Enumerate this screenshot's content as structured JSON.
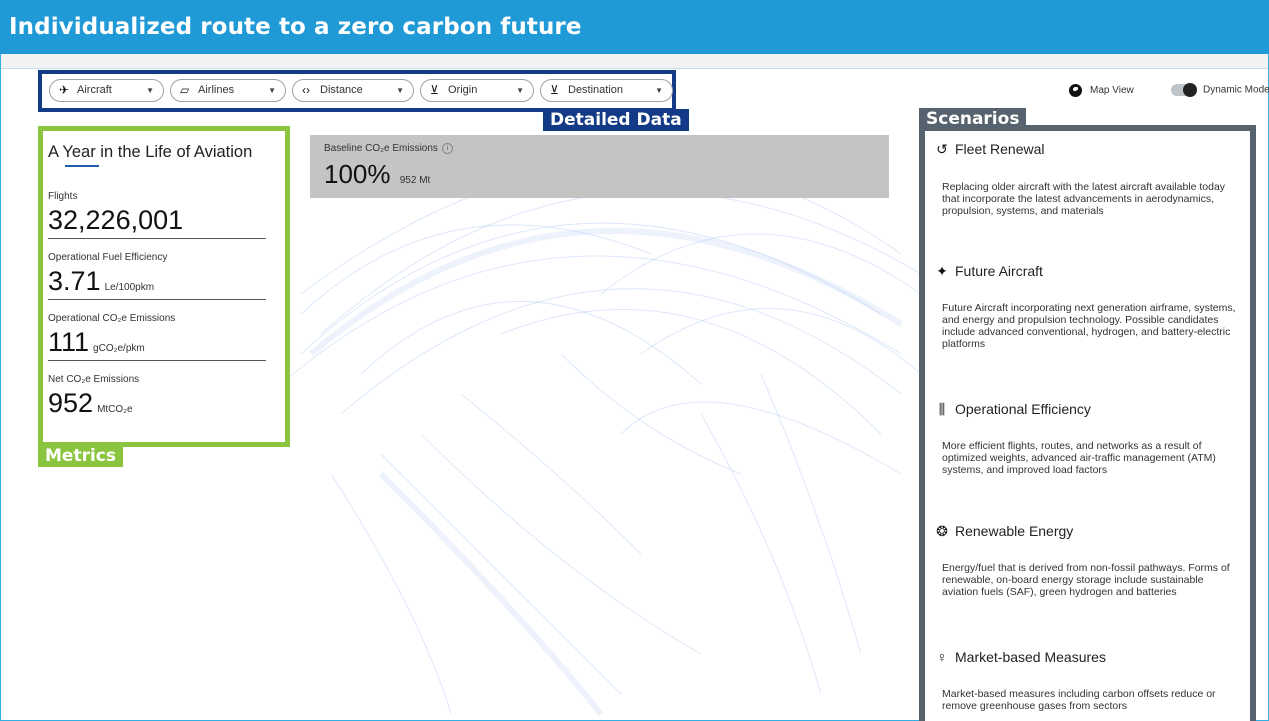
{
  "header": {
    "title": "Individualized route to a zero carbon future"
  },
  "filters": [
    {
      "icon": "✈",
      "label": "Aircraft"
    },
    {
      "icon": "▱",
      "label": "Airlines"
    },
    {
      "icon": "‹›",
      "label": "Distance"
    },
    {
      "icon": "⊻",
      "label": "Origin"
    },
    {
      "icon": "⊻",
      "label": "Destination"
    }
  ],
  "annotations": {
    "detailed_data": "Detailed Data",
    "scenarios": "Scenarios",
    "metrics": "Metrics"
  },
  "controls": {
    "map_view": "Map View",
    "dynamic_mode": "Dynamic Mode"
  },
  "metrics_panel": {
    "title": "A Year in the Life of Aviation",
    "items": [
      {
        "label": "Flights",
        "value": "32,226,001",
        "unit": ""
      },
      {
        "label": "Operational Fuel Efficiency",
        "value": "3.71",
        "unit": "Le/100pkm"
      },
      {
        "label": "Operational CO₂e Emissions",
        "value": "111",
        "unit": "gCO₂e/pkm"
      },
      {
        "label": "Net CO₂e Emissions",
        "value": "952",
        "unit": "MtCO₂e"
      }
    ]
  },
  "baseline": {
    "label": "Baseline CO₂e Emissions",
    "percent": "100%",
    "amount": "952 Mt"
  },
  "scenarios": [
    {
      "title": "Fleet Renewal",
      "icon": "↺",
      "description": "Replacing older aircraft with the latest aircraft available today that incorporate the latest advancements in aerodynamics, propulsion, systems, and materials"
    },
    {
      "title": "Future Aircraft",
      "icon": "✦",
      "description": "Future Aircraft incorporating next generation airframe, systems, and energy and propulsion technology. Possible candidates include advanced conventional, hydrogen, and battery-electric platforms"
    },
    {
      "title": "Operational Efficiency",
      "icon": "⫼",
      "description": "More efficient flights, routes, and networks as a result of optimized weights, advanced air-traffic management (ATM) systems, and improved load factors"
    },
    {
      "title": "Renewable Energy",
      "icon": "❂",
      "description": "Energy/fuel that is derived from non-fossil pathways. Forms of renewable, on-board energy storage include sustainable aviation fuels (SAF), green hydrogen and batteries"
    },
    {
      "title": "Market-based Measures",
      "icon": "♀",
      "description": "Market-based measures including carbon offsets reduce or remove greenhouse gases from sectors"
    }
  ]
}
